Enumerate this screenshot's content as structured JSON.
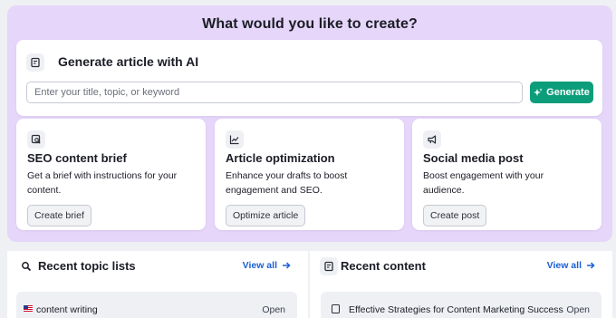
{
  "hero": {
    "title": "What would you like to create?"
  },
  "generator": {
    "title": "Generate article with AI",
    "input_placeholder": "Enter your title, topic, or keyword",
    "input_value": "",
    "button_label": "Generate"
  },
  "features": [
    {
      "icon": "doc-search-icon",
      "title": "SEO content brief",
      "description": "Get a brief with instructions for your content.",
      "button_label": "Create brief"
    },
    {
      "icon": "chart-line-icon",
      "title": "Article optimization",
      "description": "Enhance your drafts to boost engagement and SEO.",
      "button_label": "Optimize article"
    },
    {
      "icon": "megaphone-icon",
      "title": "Social media post",
      "description": "Boost engagement with your audience.",
      "button_label": "Create post"
    }
  ],
  "recent_topics": {
    "title": "Recent topic lists",
    "view_all_label": "View all",
    "items": [
      {
        "flag": "us-flag-icon",
        "label": "content writing",
        "action": "Open"
      }
    ]
  },
  "recent_content": {
    "title": "Recent content",
    "view_all_label": "View all",
    "items": [
      {
        "icon": "document-icon",
        "label": "Effective Strategies for Content Marketing Success",
        "action": "Open"
      }
    ]
  },
  "colors": {
    "hero_bg": "#e6d6f9",
    "primary_button": "#0c9d7b",
    "link": "#1a5fd6",
    "page_bg": "#eef0f4"
  }
}
